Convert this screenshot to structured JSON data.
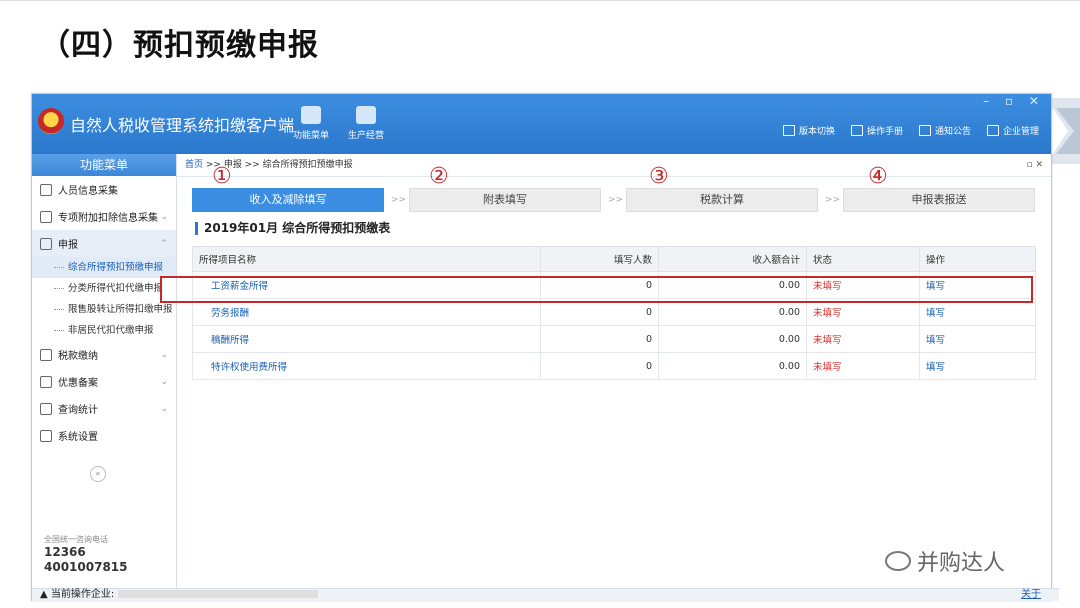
{
  "slide": {
    "title": "（四）预扣预缴申报"
  },
  "app": {
    "title": "自然人税收管理系统扣缴客户端",
    "window_controls": "– ▫ ✕",
    "toolbar": [
      {
        "label": "功能菜单",
        "icon": "menu-icon"
      },
      {
        "label": "生产经营",
        "icon": "database-icon"
      }
    ],
    "top_links": [
      {
        "label": "版本切换",
        "icon": "switch-icon"
      },
      {
        "label": "操作手册",
        "icon": "manual-icon"
      },
      {
        "label": "通知公告",
        "icon": "notice-icon"
      },
      {
        "label": "企业管理",
        "icon": "company-icon"
      }
    ]
  },
  "sidebar": {
    "header": "功能菜单",
    "items": [
      {
        "label": "人员信息采集",
        "icon": "person-icon",
        "arrow": ""
      },
      {
        "label": "专项附加扣除信息采集",
        "icon": "list-icon",
        "arrow": "⌄"
      },
      {
        "label": "申报",
        "icon": "grid-icon",
        "arrow": "⌃"
      }
    ],
    "sub_items": [
      "综合所得预扣预缴申报",
      "分类所得代扣代缴申报",
      "限售股转让所得扣缴申报",
      "非居民代扣代缴申报"
    ],
    "items2": [
      {
        "label": "税款缴纳",
        "icon": "grid-icon",
        "arrow": "⌄"
      },
      {
        "label": "优惠备案",
        "icon": "doc-icon",
        "arrow": "⌄"
      },
      {
        "label": "查询统计",
        "icon": "grid-icon",
        "arrow": "⌄"
      },
      {
        "label": "系统设置",
        "icon": "grid-icon",
        "arrow": ""
      }
    ],
    "collapse": "«",
    "hotline_label": "全国统一咨询电话",
    "hotline_1": "12366",
    "hotline_2": "4001007815"
  },
  "breadcrumb": {
    "home": "首页",
    "path": " >> 申报 >> 综合所得预扣预缴申报",
    "controls": "▫ ✕"
  },
  "steps": [
    {
      "num": "①",
      "label": "收入及减除填写",
      "active": true
    },
    {
      "num": "②",
      "label": "附表填写",
      "active": false
    },
    {
      "num": "③",
      "label": "税款计算",
      "active": false
    },
    {
      "num": "④",
      "label": "申报表报送",
      "active": false
    }
  ],
  "step_sep": ">>",
  "report": {
    "title": "2019年01月  综合所得预扣预缴表",
    "columns": [
      "所得项目名称",
      "填写人数",
      "收入额合计",
      "状态",
      "操作"
    ],
    "rows": [
      {
        "name": "工资薪金所得",
        "count": "0",
        "amount": "0.00",
        "status": "未填写",
        "action": "填写"
      },
      {
        "name": "劳务报酬",
        "count": "0",
        "amount": "0.00",
        "status": "未填写",
        "action": "填写"
      },
      {
        "name": "稿酬所得",
        "count": "0",
        "amount": "0.00",
        "status": "未填写",
        "action": "填写"
      },
      {
        "name": "特许权使用费所得",
        "count": "0",
        "amount": "0.00",
        "status": "未填写",
        "action": "填写"
      }
    ]
  },
  "statusbar": {
    "label": "当前操作企业:",
    "about": "关于"
  },
  "watermark": "并购达人",
  "colors": {
    "accent": "#2b78cd",
    "highlight": "#c62828",
    "status": "#d9302e"
  }
}
